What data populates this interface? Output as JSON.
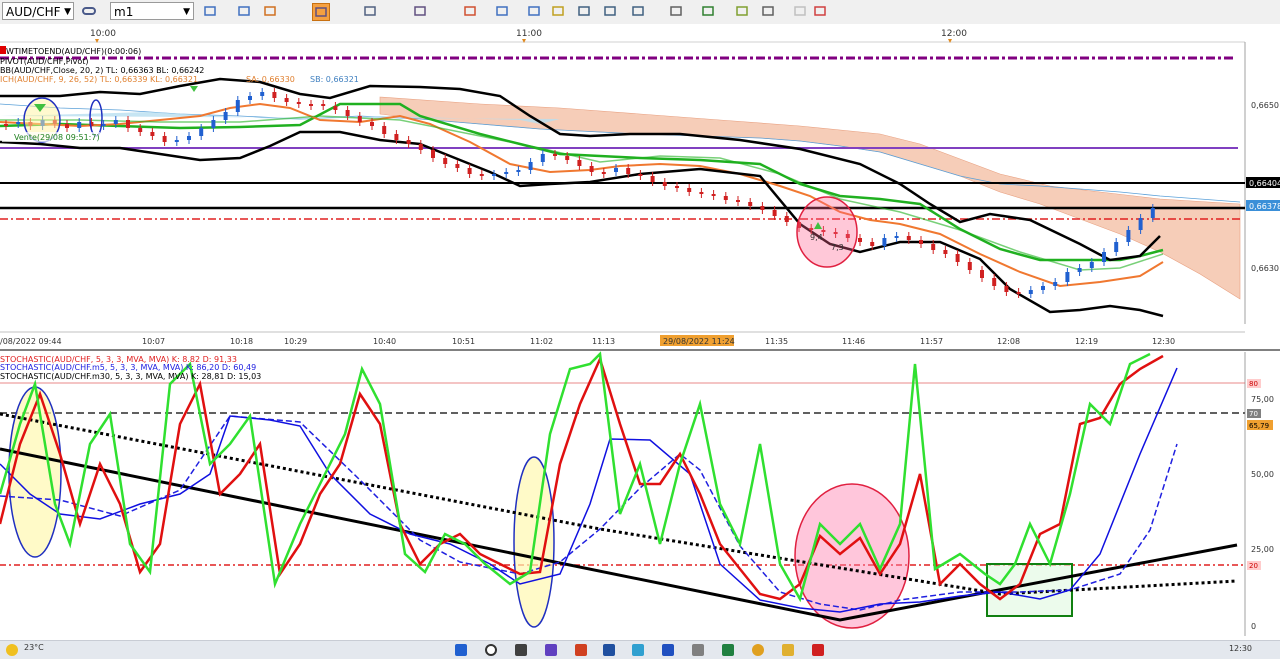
{
  "toolbar": {
    "symbol": "AUD/CHF",
    "timeframe": "m1",
    "icons": [
      "chart-type-icon",
      "bar-chart-icon",
      "indicators-icon",
      "cursor-icon",
      "zoom-in-icon",
      "zoom-fit-icon",
      "fib-icon",
      "text-icon",
      "ellipse-icon",
      "pen-icon",
      "picture-icon",
      "trend-icon",
      "channel-icon",
      "lines-icon",
      "arrow-line-icon",
      "brush-icon",
      "shape-icon",
      "eraser-icon",
      "delete-icon"
    ],
    "active_icon": 3
  },
  "price_panel": {
    "time_labels_top": [
      "10:00",
      "11:00",
      "12:00"
    ],
    "indicator_lines": [
      {
        "text": "WTIMETOEND(AUD/CHF)(0:00:06)",
        "color": "#000000"
      },
      {
        "text": "PIVOT(AUD/CHF,Pivot)",
        "color": "#000000"
      },
      {
        "text": "BB(AUD/CHF,Close, 20, 2)  TL: 0,66363  BL: 0,66242",
        "color": "#000000"
      },
      {
        "text": "ICH(AUD/CHF, 9, 26, 52)  TL: 0,66339  KL: 0,66321",
        "color": "#e08030"
      },
      {
        "text": "SA: 0,66330",
        "color": "#e08030"
      },
      {
        "text": "SB: 0,66321",
        "color": "#4080c0"
      }
    ],
    "price_axis": [
      "0,6650",
      "0,6630"
    ],
    "price_tags": [
      {
        "label": "0,66404",
        "bg": "#000000",
        "fg": "#ffffff"
      },
      {
        "label": "0,66378",
        "bg": "#3a8fd8",
        "fg": "#ffffff"
      }
    ],
    "time_axis": [
      "/08/2022 09:44",
      "10:07",
      "10:18",
      "10:29",
      "10:40",
      "10:51",
      "11:02",
      "11:13",
      "29/08/2022 11:24",
      "11:35",
      "11:46",
      "11:57",
      "12:08",
      "12:19",
      "12:30"
    ],
    "annotations": {
      "vente": "Vente(29/08 09:51:7)",
      "circle_a": "9,4",
      "circle_b": "7,3"
    }
  },
  "stoch_panel": {
    "legend": [
      {
        "text": "STOCHASTIC(AUD/CHF, 5, 3, 3, MVA, MVA)  K: 8.82  D: 91,33",
        "color": "#e02020"
      },
      {
        "text": "STOCHASTIC(AUD/CHF.m5, 5, 3, 3, MVA, MVA)  K: 86,20  D: 60,49",
        "color": "#2020e0"
      },
      {
        "text": "STOCHASTIC(AUD/CHF.m30, 5, 3, 3, MVA, MVA)  K: 28,81  D: 15,03",
        "color": "#000000"
      }
    ],
    "axis": [
      "75,00",
      "50,00",
      "25,00",
      "0"
    ],
    "tags": [
      {
        "label": "80",
        "bg": "#ffcccc",
        "fg": "#cc0000"
      },
      {
        "label": "70",
        "bg": "#808080",
        "fg": "#ffffff"
      },
      {
        "label": "65,79",
        "bg": "#f0a030",
        "fg": "#000000"
      },
      {
        "label": "20",
        "bg": "#ffcccc",
        "fg": "#cc0000"
      }
    ],
    "levels": {
      "upper": 80,
      "mid": 70,
      "lower": 20
    }
  },
  "chart_data": {
    "type": "line",
    "series": [
      {
        "name": "STOCHASTIC(AUD/CHF, 5, 3, 3, MVA, MVA) D",
        "values": [
          72,
          80,
          30,
          18,
          55,
          92,
          60,
          45,
          28,
          10,
          88,
          52,
          12,
          33,
          68,
          92,
          25,
          10,
          25,
          72,
          22,
          15,
          35,
          62,
          98,
          55,
          20,
          58,
          30,
          78,
          45,
          52,
          14,
          8,
          22,
          48,
          28,
          40,
          42,
          18,
          28,
          22,
          18,
          55,
          78,
          85,
          95,
          98
        ]
      },
      {
        "name": "STOCHASTIC(AUD/CHF.m5, 5, 3, 3, MVA, MVA) K",
        "values": [
          45,
          38,
          30,
          25,
          30,
          78,
          76,
          65,
          45,
          30,
          28,
          22,
          18,
          12,
          38,
          72,
          72,
          45,
          32,
          28,
          12,
          10,
          8,
          12,
          15,
          18,
          25,
          35,
          55,
          75,
          90
        ]
      }
    ]
  },
  "taskbar": {
    "weather": "23°C",
    "clock": "12:30"
  }
}
